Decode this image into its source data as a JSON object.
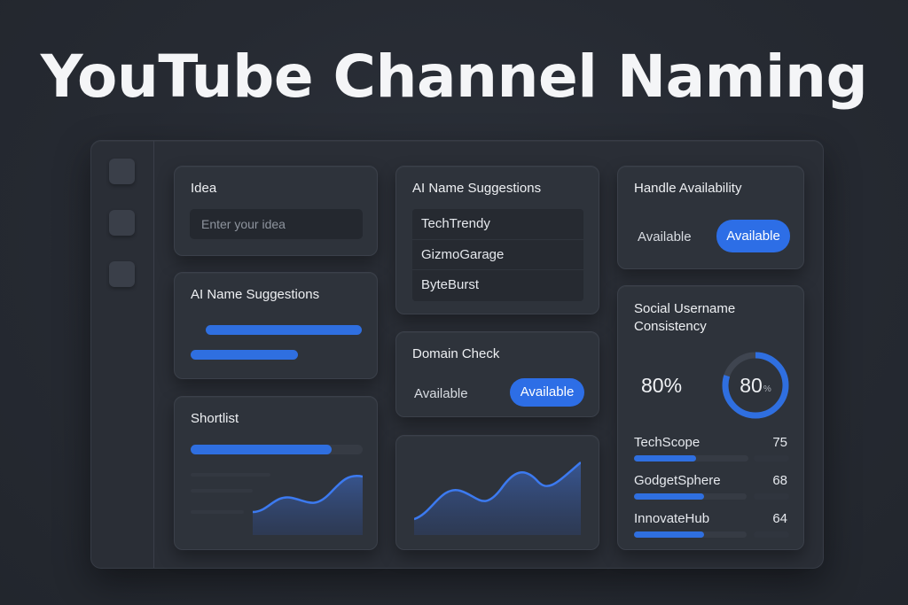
{
  "hero": {
    "title": "YouTube Channel Naming"
  },
  "colors": {
    "accent": "#2f6fe0",
    "background": "#262a32",
    "card": "#2e333b"
  },
  "sidebar": {
    "items": [
      {
        "icon": "square-icon"
      },
      {
        "icon": "square-icon"
      },
      {
        "icon": "square-icon"
      }
    ]
  },
  "idea": {
    "title": "Idea",
    "placeholder": "Enter your idea",
    "value": ""
  },
  "ai_suggestions_main": {
    "title": "AI Name Suggestions",
    "items": [
      "TechTrendy",
      "GizmoGarage",
      "ByteBurst"
    ]
  },
  "ai_suggestions_small": {
    "title": "AI Name Suggestions"
  },
  "handle": {
    "title": "Handle Availability",
    "status_label": "Available",
    "status_button": "Available"
  },
  "domain": {
    "title": "Domain Check",
    "status_label": "Available",
    "status_button": "Available"
  },
  "shortlist": {
    "title": "Shortlist",
    "progress": 0.82
  },
  "social": {
    "title_line1": "Social Username",
    "title_line2": "Consistency",
    "percent_text": "80%",
    "donut_value": "80",
    "donut_unit": "%",
    "donut_fraction": 0.8,
    "items": [
      {
        "name": "TechScope",
        "score": "75",
        "fill": 0.55
      },
      {
        "name": "GodgetSphere",
        "score": "68",
        "fill": 0.62
      },
      {
        "name": "InnovateHub",
        "score": "64",
        "fill": 0.62
      }
    ]
  },
  "chart_data": [
    {
      "type": "area",
      "note": "decorative trend sparkline",
      "values": [
        0.1,
        0.3,
        0.55,
        0.4,
        0.65,
        0.95
      ]
    },
    {
      "type": "area",
      "note": "decorative trend sparkline",
      "values": [
        0.15,
        0.55,
        0.45,
        0.9,
        0.6,
        0.95
      ]
    }
  ]
}
